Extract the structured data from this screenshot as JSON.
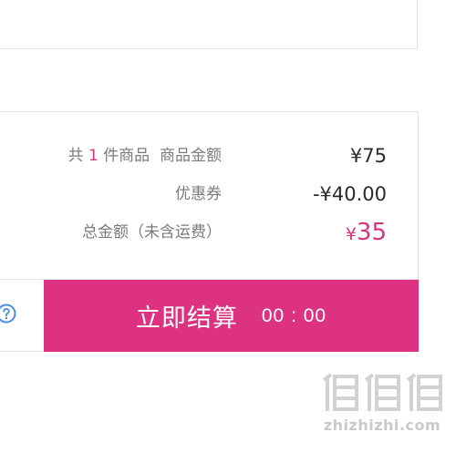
{
  "summary": {
    "items_prefix": "共",
    "items_count": "1",
    "items_suffix": "件商品",
    "goods_amount_label": "商品金额",
    "goods_amount_value": "¥75",
    "coupon_label": "优惠券",
    "coupon_value": "-¥40.00",
    "total_label": "总金额（未含运费）",
    "total_currency": "¥",
    "total_value": "35"
  },
  "checkout": {
    "button_label": "立即结算",
    "timer": "00 : 00"
  },
  "icons": {
    "help": "help-circle-icon"
  },
  "watermark": {
    "text": "zhizhizhi.com"
  },
  "colors": {
    "accent": "#dc3281",
    "price_highlight": "#d9357e",
    "help_icon": "#4a90e2"
  }
}
